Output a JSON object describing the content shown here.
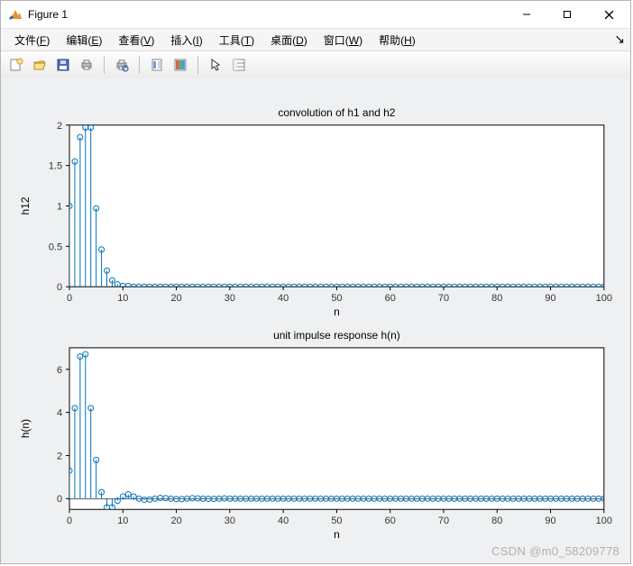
{
  "window": {
    "title": "Figure 1",
    "min_tooltip": "Minimize",
    "max_tooltip": "Maximize",
    "close_tooltip": "Close"
  },
  "menu": {
    "items": [
      {
        "label": "文件",
        "accel": "F"
      },
      {
        "label": "编辑",
        "accel": "E"
      },
      {
        "label": "查看",
        "accel": "V"
      },
      {
        "label": "插入",
        "accel": "I"
      },
      {
        "label": "工具",
        "accel": "T"
      },
      {
        "label": "桌面",
        "accel": "D"
      },
      {
        "label": "窗口",
        "accel": "W"
      },
      {
        "label": "帮助",
        "accel": "H"
      }
    ]
  },
  "toolbar_icons": [
    "new-figure-icon",
    "open-icon",
    "save-icon",
    "print-icon",
    "sep",
    "print-preview-icon",
    "sep",
    "link-icon",
    "colorbar-icon",
    "sep",
    "pointer-icon",
    "property-editor-icon"
  ],
  "watermark": "CSDN @m0_58209778",
  "colors": {
    "series": "#0072BD",
    "axes": "#000000",
    "panel": "#eef0f2"
  },
  "chart_data": [
    {
      "type": "bar",
      "title": "convolution of h1 and h2",
      "xlabel": "n",
      "ylabel": "h12",
      "xlim": [
        0,
        100
      ],
      "ylim": [
        0,
        2
      ],
      "xticks": [
        0,
        10,
        20,
        30,
        40,
        50,
        60,
        70,
        80,
        90,
        100
      ],
      "yticks": [
        0,
        0.5,
        1,
        1.5,
        2
      ],
      "x": [
        0,
        1,
        2,
        3,
        4,
        5,
        6,
        7,
        8,
        9,
        10,
        11,
        12,
        13,
        14,
        15,
        16,
        17,
        18,
        19,
        20,
        21,
        22,
        23,
        24,
        25,
        26,
        27,
        28,
        29,
        30,
        31,
        32,
        33,
        34,
        35,
        36,
        37,
        38,
        39,
        40,
        41,
        42,
        43,
        44,
        45,
        46,
        47,
        48,
        49,
        50,
        51,
        52,
        53,
        54,
        55,
        56,
        57,
        58,
        59,
        60,
        61,
        62,
        63,
        64,
        65,
        66,
        67,
        68,
        69,
        70,
        71,
        72,
        73,
        74,
        75,
        76,
        77,
        78,
        79,
        80,
        81,
        82,
        83,
        84,
        85,
        86,
        87,
        88,
        89,
        90,
        91,
        92,
        93,
        94,
        95,
        96,
        97,
        98,
        99,
        100
      ],
      "values": [
        1.0,
        1.55,
        1.85,
        1.97,
        1.97,
        0.97,
        0.46,
        0.2,
        0.08,
        0.03,
        0.01,
        0.01,
        0.0,
        0.0,
        0.0,
        0.0,
        0.0,
        0.0,
        0.0,
        0.0,
        0.0,
        0.0,
        0.0,
        0.0,
        0.0,
        0.0,
        0.0,
        0.0,
        0.0,
        0.0,
        0.0,
        0.0,
        0.0,
        0.0,
        0.0,
        0.0,
        0.0,
        0.0,
        0.0,
        0.0,
        0.0,
        0.0,
        0.0,
        0.0,
        0.0,
        0.0,
        0.0,
        0.0,
        0.0,
        0.0,
        0.0,
        0.0,
        0.0,
        0.0,
        0.0,
        0.0,
        0.0,
        0.0,
        0.0,
        0.0,
        0.0,
        0.0,
        0.0,
        0.0,
        0.0,
        0.0,
        0.0,
        0.0,
        0.0,
        0.0,
        0.0,
        0.0,
        0.0,
        0.0,
        0.0,
        0.0,
        0.0,
        0.0,
        0.0,
        0.0,
        0.0,
        0.0,
        0.0,
        0.0,
        0.0,
        0.0,
        0.0,
        0.0,
        0.0,
        0.0,
        0.0,
        0.0,
        0.0,
        0.0,
        0.0,
        0.0,
        0.0,
        0.0,
        0.0,
        0.0,
        0.0
      ]
    },
    {
      "type": "bar",
      "title": "unit impulse response h(n)",
      "xlabel": "n",
      "ylabel": "h(n)",
      "xlim": [
        0,
        100
      ],
      "ylim": [
        -0.5,
        7
      ],
      "xticks": [
        0,
        10,
        20,
        30,
        40,
        50,
        60,
        70,
        80,
        90,
        100
      ],
      "yticks": [
        0,
        2,
        4,
        6
      ],
      "x": [
        0,
        1,
        2,
        3,
        4,
        5,
        6,
        7,
        8,
        9,
        10,
        11,
        12,
        13,
        14,
        15,
        16,
        17,
        18,
        19,
        20,
        21,
        22,
        23,
        24,
        25,
        26,
        27,
        28,
        29,
        30,
        31,
        32,
        33,
        34,
        35,
        36,
        37,
        38,
        39,
        40,
        41,
        42,
        43,
        44,
        45,
        46,
        47,
        48,
        49,
        50,
        51,
        52,
        53,
        54,
        55,
        56,
        57,
        58,
        59,
        60,
        61,
        62,
        63,
        64,
        65,
        66,
        67,
        68,
        69,
        70,
        71,
        72,
        73,
        74,
        75,
        76,
        77,
        78,
        79,
        80,
        81,
        82,
        83,
        84,
        85,
        86,
        87,
        88,
        89,
        90,
        91,
        92,
        93,
        94,
        95,
        96,
        97,
        98,
        99,
        100
      ],
      "values": [
        1.3,
        4.2,
        6.6,
        6.7,
        4.2,
        1.8,
        0.3,
        -0.4,
        -0.4,
        -0.1,
        0.1,
        0.2,
        0.1,
        0.0,
        -0.05,
        -0.04,
        0.0,
        0.03,
        0.02,
        0.0,
        -0.02,
        -0.02,
        0.0,
        0.02,
        0.01,
        0.0,
        -0.01,
        -0.01,
        0.0,
        0.01,
        0.0,
        0.0,
        0.0,
        0.0,
        0.0,
        0.0,
        0.0,
        0.0,
        0.0,
        0.0,
        0.0,
        0.0,
        0.0,
        0.0,
        0.0,
        0.0,
        0.0,
        0.0,
        0.0,
        0.0,
        0.0,
        0.0,
        0.0,
        0.0,
        0.0,
        0.0,
        0.0,
        0.0,
        0.0,
        0.0,
        0.0,
        0.0,
        0.0,
        0.0,
        0.0,
        0.0,
        0.0,
        0.0,
        0.0,
        0.0,
        0.0,
        0.0,
        0.0,
        0.0,
        0.0,
        0.0,
        0.0,
        0.0,
        0.0,
        0.0,
        0.0,
        0.0,
        0.0,
        0.0,
        0.0,
        0.0,
        0.0,
        0.0,
        0.0,
        0.0,
        0.0,
        0.0,
        0.0,
        0.0,
        0.0,
        0.0,
        0.0,
        0.0,
        0.0,
        0.0,
        0.0
      ]
    }
  ]
}
